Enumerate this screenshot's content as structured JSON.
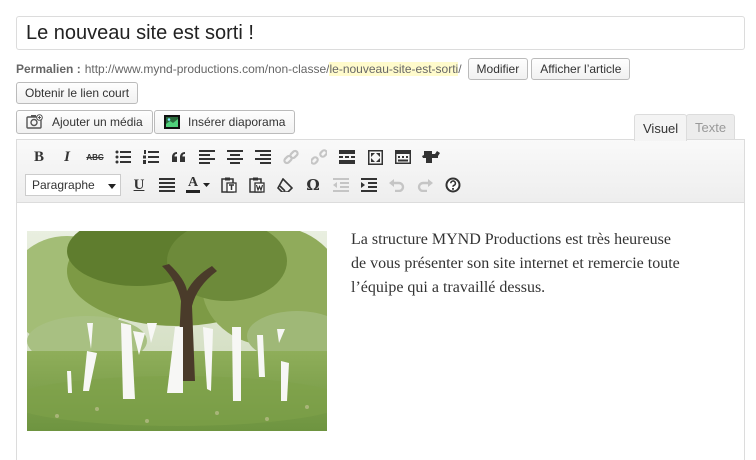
{
  "post": {
    "title": "Le nouveau site est sorti !"
  },
  "permalink": {
    "label": "Permalien :",
    "base_url": "http://www.mynd-productions.com/non-classe/",
    "slug": "le-nouveau-site-est-sorti",
    "trailing": "/",
    "edit_button": "Modifier",
    "view_button": "Afficher l’article",
    "shortlink_button": "Obtenir le lien court"
  },
  "media": {
    "add_media_button": "Ajouter un média",
    "insert_slideshow_button": "Insérer diaporama"
  },
  "editor_tabs": {
    "visual": "Visuel",
    "text": "Texte",
    "active": "visual"
  },
  "toolbar": {
    "row1": [
      "bold-icon",
      "italic-icon",
      "strikethrough-icon",
      "bullet-list-icon",
      "numbered-list-icon",
      "blockquote-icon",
      "align-left-icon",
      "align-center-icon",
      "align-right-icon",
      "link-icon",
      "unlink-icon",
      "read-more-icon",
      "fullscreen-icon",
      "toggle-toolbar-icon",
      "plugin-icon"
    ],
    "row2": [
      "underline-icon",
      "justify-icon",
      "text-color-icon",
      "paste-text-icon",
      "paste-word-icon",
      "clear-formatting-icon",
      "special-character-icon",
      "outdent-icon",
      "indent-icon",
      "undo-icon",
      "redo-icon",
      "help-icon"
    ],
    "format_select": "Paragraphe",
    "bold_glyph": "B",
    "italic_glyph": "I",
    "strike_glyph": "ABC",
    "underline_glyph": "U",
    "color_glyph": "A",
    "omega_glyph": "Ω"
  },
  "content": {
    "image_alt": "MYND letters standing in a grassy park under a large tree",
    "paragraph": "La structure MYND Productions est très heureuse de vous présenter son site internet et remercie toute l’équipe qui a travaillé dessus."
  },
  "colors": {
    "slug_highlight": "#fffbcc",
    "border": "#dcdcdc",
    "toolbar_bg": "#eeeeee"
  }
}
